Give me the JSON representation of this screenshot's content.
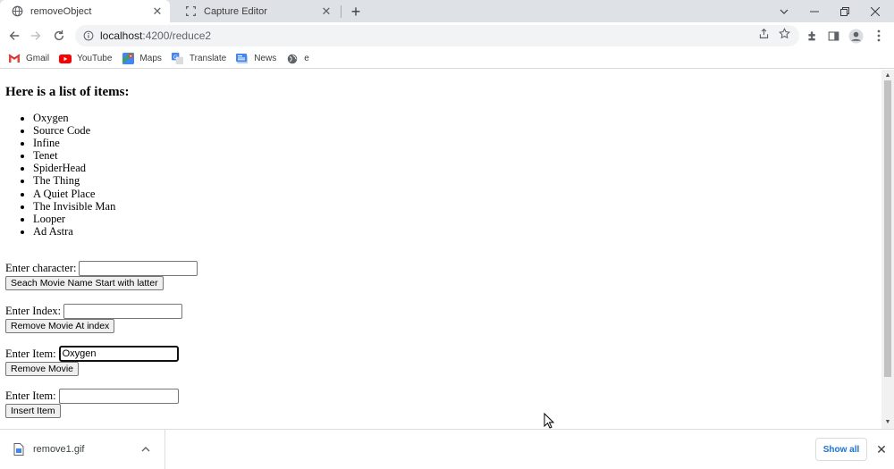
{
  "browser": {
    "tabs": [
      {
        "title": "removeObject",
        "active": true,
        "icon": "globe-icon"
      },
      {
        "title": "Capture Editor",
        "active": false,
        "icon": "capture-icon"
      }
    ],
    "url_host": "localhost",
    "url_path": ":4200/reduce2",
    "bookmarks": [
      {
        "label": "Gmail",
        "icon": "gmail-icon"
      },
      {
        "label": "YouTube",
        "icon": "youtube-icon"
      },
      {
        "label": "Maps",
        "icon": "maps-icon"
      },
      {
        "label": "Translate",
        "icon": "translate-icon"
      },
      {
        "label": "News",
        "icon": "news-icon"
      },
      {
        "label": "e",
        "icon": "globe-icon"
      }
    ]
  },
  "page": {
    "heading": "Here is a list of items:",
    "items": [
      "Oxygen",
      "Source Code",
      "Infine",
      "Tenet",
      "SpiderHead",
      "The Thing",
      "A Quiet Place",
      "The Invisible Man",
      "Looper",
      "Ad Astra"
    ],
    "search": {
      "label": "Enter character:",
      "value": "",
      "button": "Seach Movie Name Start with latter"
    },
    "remove_index": {
      "label": "Enter Index:",
      "value": "",
      "button": "Remove Movie At index"
    },
    "remove_item": {
      "label": "Enter Item:",
      "value": "Oxygen",
      "button": "Remove Movie"
    },
    "insert_item": {
      "label": "Enter Item:",
      "value": "",
      "button": "Insert Item"
    }
  },
  "downloads": {
    "file_name": "remove1.gif",
    "show_all": "Show all"
  },
  "colors": {
    "accent": "#1a73e8",
    "tab_strip": "#dee1e6",
    "omnibox": "#f1f3f4"
  }
}
